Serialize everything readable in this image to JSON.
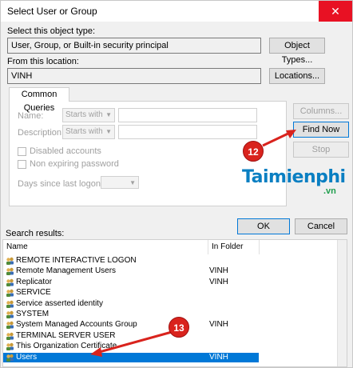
{
  "window": {
    "title": "Select User or Group",
    "close_glyph": "✕"
  },
  "object_type": {
    "label": "Select this object type:",
    "value": "User, Group, or Built-in security principal",
    "button": "Object Types..."
  },
  "location": {
    "label": "From this location:",
    "value": "VINH",
    "button": "Locations..."
  },
  "queries": {
    "tab": "Common Queries",
    "name_label": "Name:",
    "name_mode": "Starts with",
    "description_label": "Description:",
    "description_mode": "Starts with",
    "disabled_accounts": "Disabled accounts",
    "non_expiring_password": "Non expiring password",
    "days_label": "Days since last logon:",
    "columns_button": "Columns...",
    "find_now_button": "Find Now",
    "stop_button": "Stop"
  },
  "ok_button": "OK",
  "cancel_button": "Cancel",
  "search_results_label": "Search results:",
  "results": {
    "headers": {
      "name": "Name",
      "folder": "In Folder"
    },
    "rows": [
      {
        "name": "REMOTE INTERACTIVE LOGON",
        "folder": ""
      },
      {
        "name": "Remote Management Users",
        "folder": "VINH"
      },
      {
        "name": "Replicator",
        "folder": "VINH"
      },
      {
        "name": "SERVICE",
        "folder": ""
      },
      {
        "name": "Service asserted identity",
        "folder": ""
      },
      {
        "name": "SYSTEM",
        "folder": ""
      },
      {
        "name": "System Managed Accounts Group",
        "folder": "VINH"
      },
      {
        "name": "TERMINAL SERVER USER",
        "folder": ""
      },
      {
        "name": "This Organization Certificate",
        "folder": ""
      },
      {
        "name": "Users",
        "folder": "VINH",
        "selected": true
      }
    ]
  },
  "annotations": {
    "step12": "12",
    "step13": "13"
  },
  "watermark": {
    "brand": "Taimienphi",
    "suffix": ".vn"
  },
  "colors": {
    "accent": "#0078d7",
    "close": "#e81123",
    "badge": "#d9231d",
    "arrow": "#d9231d"
  }
}
